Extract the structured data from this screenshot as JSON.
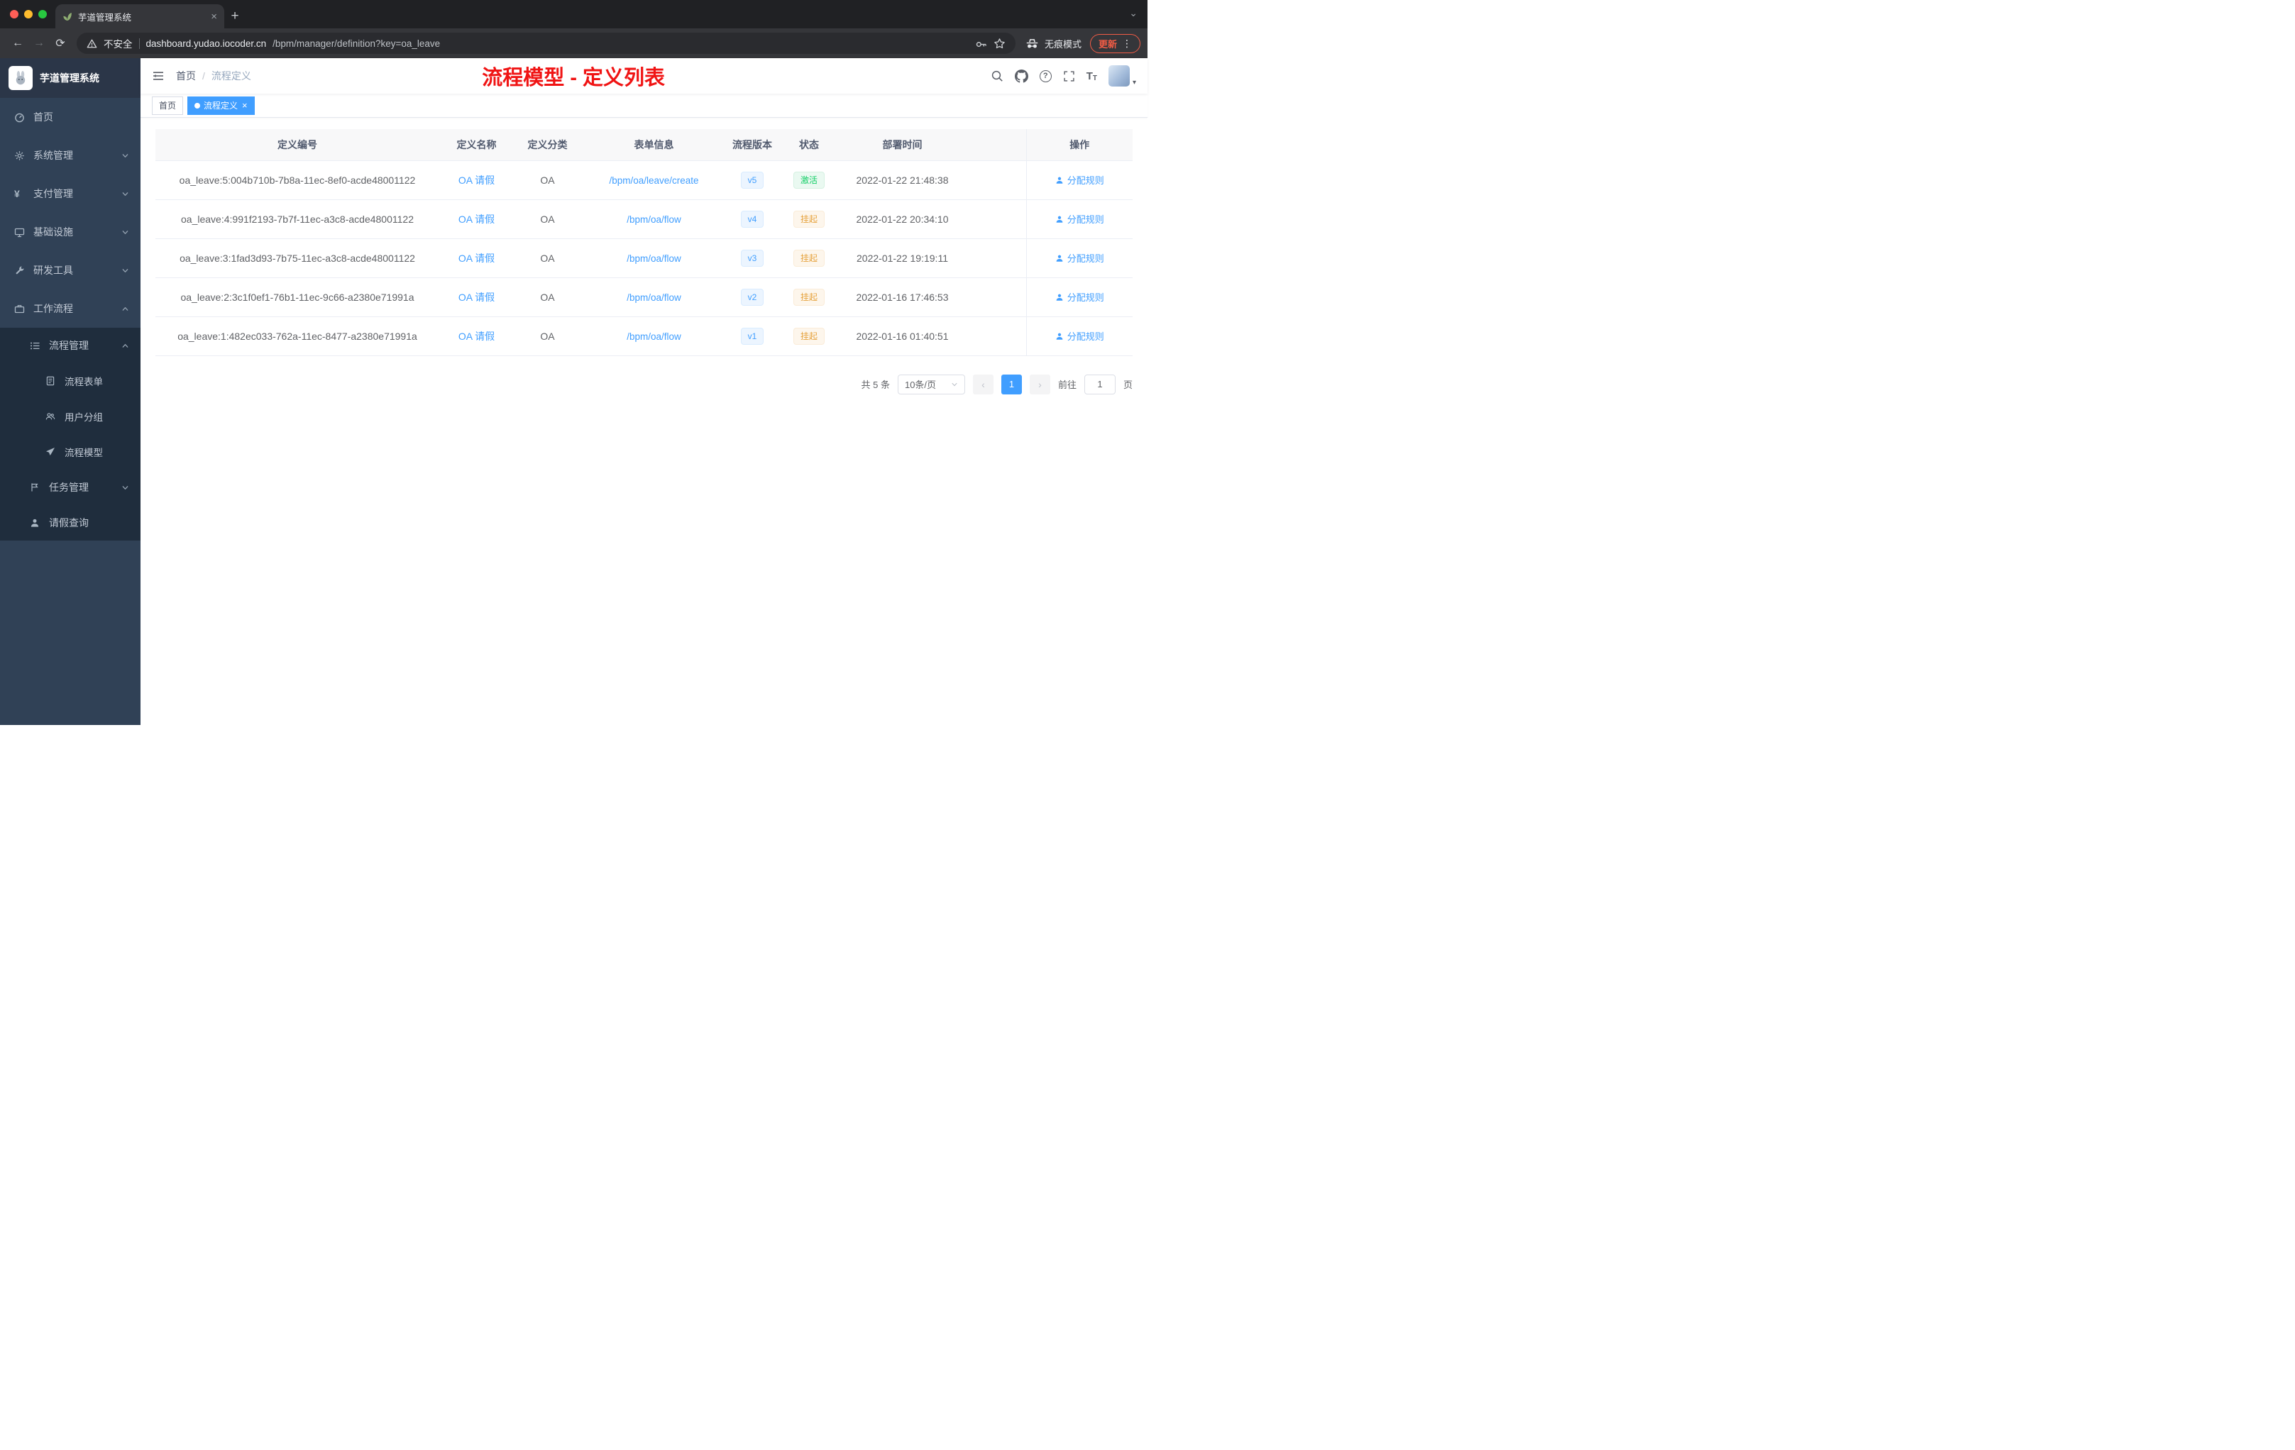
{
  "glyphs": {
    "yen": "¥",
    "question": "?",
    "caret_down": "▾"
  },
  "browser": {
    "tab_title": "芋道管理系统",
    "tab_close_glyph": "×",
    "new_tab_glyph": "+",
    "tabstrip_chevron_glyph": "⌄",
    "back_glyph": "←",
    "forward_glyph": "→",
    "reload_glyph": "⟳",
    "security_label": "不安全",
    "url_domain": "dashboard.yudao.iocoder.cn",
    "url_path": "/bpm/manager/definition?key=oa_leave",
    "incognito_label": "无痕模式",
    "update_label": "更新",
    "menu_glyph": "⋮"
  },
  "sidebar": {
    "logo_title": "芋道管理系统",
    "items": [
      {
        "label": "首页"
      },
      {
        "label": "系统管理"
      },
      {
        "label": "支付管理"
      },
      {
        "label": "基础设施"
      },
      {
        "label": "研发工具"
      },
      {
        "label": "工作流程"
      },
      {
        "label": "流程管理"
      },
      {
        "label": "流程表单"
      },
      {
        "label": "用户分组"
      },
      {
        "label": "流程模型"
      },
      {
        "label": "任务管理"
      },
      {
        "label": "请假查询"
      }
    ]
  },
  "navbar": {
    "breadcrumb_home": "首页",
    "breadcrumb_separator": "/",
    "breadcrumb_current": "流程定义",
    "annotation": "流程模型 - 定义列表"
  },
  "tags": {
    "home": "首页",
    "active": "流程定义",
    "close": "×"
  },
  "table": {
    "headers": [
      "定义编号",
      "定义名称",
      "定义分类",
      "表单信息",
      "流程版本",
      "状态",
      "部署时间",
      "操作"
    ],
    "rows": [
      {
        "id": "oa_leave:5:004b710b-7b8a-11ec-8ef0-acde48001122",
        "name": "OA 请假",
        "category": "OA",
        "form": "/bpm/oa/leave/create",
        "version": "v5",
        "status": "激活",
        "time": "2022-01-22 21:48:38",
        "action": "分配规则"
      },
      {
        "id": "oa_leave:4:991f2193-7b7f-11ec-a3c8-acde48001122",
        "name": "OA 请假",
        "category": "OA",
        "form": "/bpm/oa/flow",
        "version": "v4",
        "status": "挂起",
        "time": "2022-01-22 20:34:10",
        "action": "分配规则"
      },
      {
        "id": "oa_leave:3:1fad3d93-7b75-11ec-a3c8-acde48001122",
        "name": "OA 请假",
        "category": "OA",
        "form": "/bpm/oa/flow",
        "version": "v3",
        "status": "挂起",
        "time": "2022-01-22 19:19:11",
        "action": "分配规则"
      },
      {
        "id": "oa_leave:2:3c1f0ef1-76b1-11ec-9c66-a2380e71991a",
        "name": "OA 请假",
        "category": "OA",
        "form": "/bpm/oa/flow",
        "version": "v2",
        "status": "挂起",
        "time": "2022-01-16 17:46:53",
        "action": "分配规则"
      },
      {
        "id": "oa_leave:1:482ec033-762a-11ec-8477-a2380e71991a",
        "name": "OA 请假",
        "category": "OA",
        "form": "/bpm/oa/flow",
        "version": "v1",
        "status": "挂起",
        "time": "2022-01-16 01:40:51",
        "action": "分配规则"
      }
    ]
  },
  "pagination": {
    "total": "共 5 条",
    "page_size": "10条/页",
    "prev": "‹",
    "current_page": "1",
    "next": "›",
    "goto_label": "前往",
    "goto_value": "1",
    "unit": "页"
  }
}
